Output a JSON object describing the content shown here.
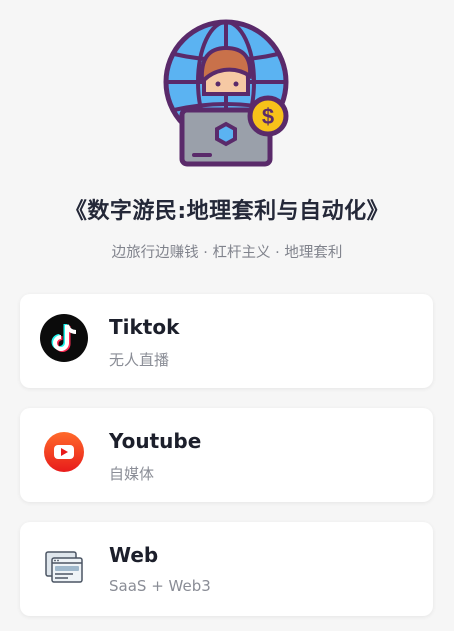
{
  "hero": {
    "illustration_icon": "digital-nomad-globe-laptop-dollar-icon",
    "title": "《数字游民:地理套利与自动化》",
    "tagline": "边旅行边赚钱 · 杠杆主义 · 地理套利"
  },
  "cards": [
    {
      "icon": "tiktok-icon",
      "title": "Tiktok",
      "subtitle": "无人直播"
    },
    {
      "icon": "youtube-icon",
      "title": "Youtube",
      "subtitle": "自媒体"
    },
    {
      "icon": "web-browser-icon",
      "title": "Web",
      "subtitle": "SaaS + Web3"
    }
  ],
  "colors": {
    "background": "#f6f6f6",
    "card": "#ffffff",
    "globe": "#5bb3f2",
    "outline": "#5a2a6a",
    "youtube": "#ff3b1f",
    "dollar": "#f7c21a"
  }
}
